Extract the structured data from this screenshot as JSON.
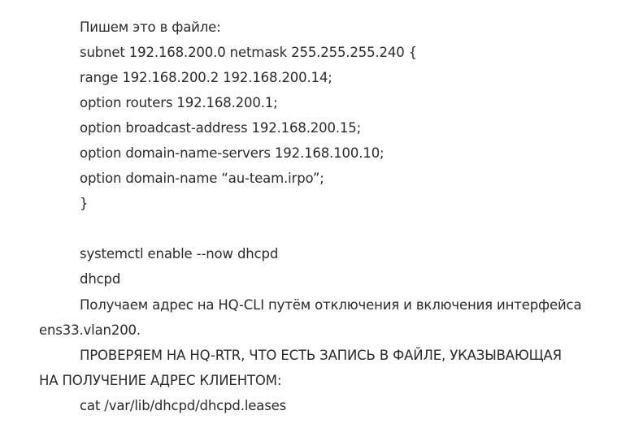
{
  "document": {
    "lines": [
      "Пишем это в файле:",
      "subnet 192.168.200.0 netmask 255.255.255.240 {",
      "range 192.168.200.2 192.168.200.14;",
      "option routers 192.168.200.1;",
      "option broadcast-address 192.168.200.15;",
      "option domain-name-servers 192.168.100.10;",
      "option domain-name “au-team.irpo”;",
      "}",
      "systemctl enable --now dhcpd",
      "dhcpd"
    ],
    "para1": {
      "first": "Получаем адрес на HQ-CLI путём отключения и включения интерфейса",
      "rest": "ens33.vlan200."
    },
    "para2": {
      "first": "ПРОВЕРЯЕМ НА HQ-RTR, ЧТО ЕСТЬ ЗАПИСЬ В ФАЙЛЕ, УКАЗЫВАЮЩАЯ",
      "rest": "НА ПОЛУЧЕНИЕ АДРЕС КЛИЕНТОМ:"
    },
    "last_line": "cat /var/lib/dhcpd/dhcpd.leases"
  }
}
